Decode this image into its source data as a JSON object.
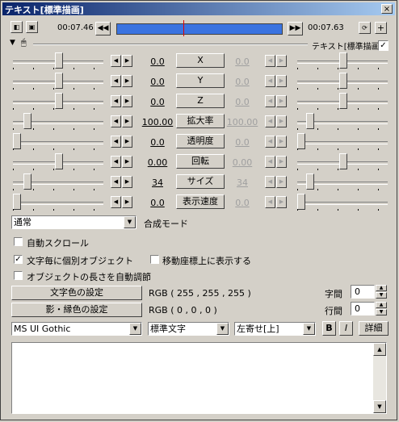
{
  "window": {
    "title": "テキスト[標準描画]",
    "close_label": "×"
  },
  "timeline": {
    "start_time": "00:07.46",
    "end_time": "00:07.63",
    "prev_icon": "skip-back-icon",
    "next_icon": "skip-forward-icon"
  },
  "filter": {
    "name": "テキスト[標準描画]",
    "enabled": true
  },
  "params": [
    {
      "label": "X",
      "left_value": "0.0",
      "right_value": "0.0",
      "right_gray": true
    },
    {
      "label": "Y",
      "left_value": "0.0",
      "right_value": "0.0",
      "right_gray": true
    },
    {
      "label": "Z",
      "left_value": "0.0",
      "right_value": "0.0",
      "right_gray": true
    },
    {
      "label": "拡大率",
      "left_value": "100.00",
      "right_value": "100.00",
      "right_gray": true
    },
    {
      "label": "透明度",
      "left_value": "0.0",
      "right_value": "0.0",
      "right_gray": true
    },
    {
      "label": "回転",
      "left_value": "0.00",
      "right_value": "0.00",
      "right_gray": true
    },
    {
      "label": "サイズ",
      "left_value": "34",
      "right_value": "34",
      "right_gray": true
    },
    {
      "label": "表示速度",
      "left_value": "0.0",
      "right_value": "0.0",
      "right_gray": true
    }
  ],
  "blend": {
    "value": "通常",
    "label": "合成モード"
  },
  "options": {
    "auto_scroll": {
      "label": "自動スクロール",
      "checked": false
    },
    "per_char": {
      "label": "文字毎に個別オブジェクト",
      "checked": true
    },
    "show_on_path": {
      "label": "移動座標上に表示する",
      "checked": false
    },
    "auto_length": {
      "label": "オブジェクトの長さを自動調節",
      "checked": false
    }
  },
  "text_color": {
    "button": "文字色の設定",
    "value": "RGB ( 255 , 255 , 255 )"
  },
  "shadow_color": {
    "button": "影・縁色の設定",
    "value": "RGB ( 0 , 0 , 0 )"
  },
  "char_spacing": {
    "label": "字間",
    "value": "0"
  },
  "line_spacing": {
    "label": "行間",
    "value": "0"
  },
  "font": {
    "value": "MS UI Gothic"
  },
  "style": {
    "value": "標準文字"
  },
  "align": {
    "value": "左寄せ[上]"
  },
  "bold": "B",
  "italic": "I",
  "details": "詳細",
  "text_content": ""
}
